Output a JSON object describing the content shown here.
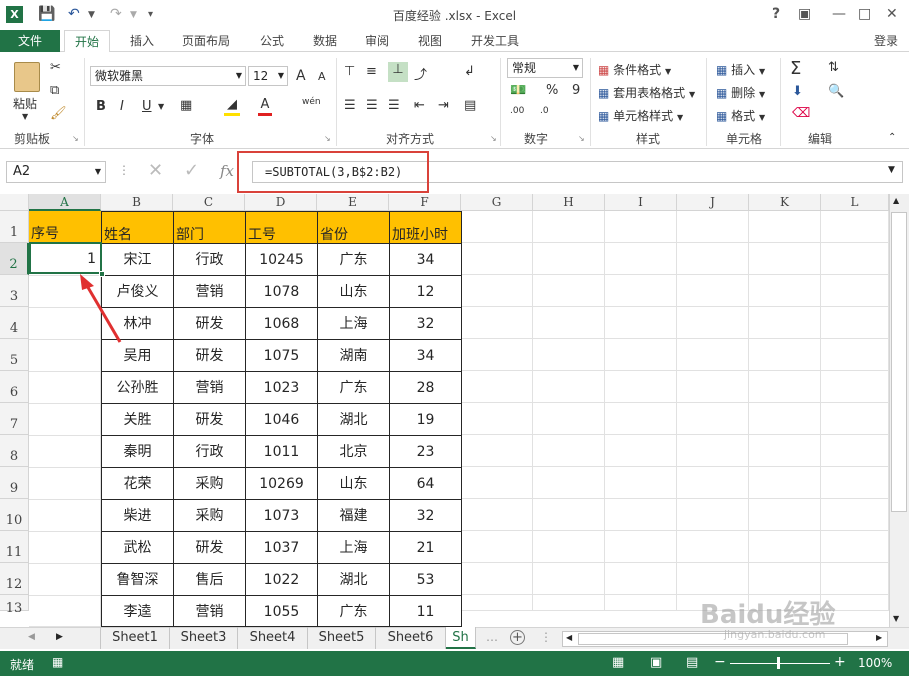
{
  "window": {
    "title": "百度经验 .xlsx - Excel",
    "help": "?",
    "login": "登录"
  },
  "menu": {
    "file": "文件",
    "tabs": [
      "开始",
      "插入",
      "页面布局",
      "公式",
      "数据",
      "审阅",
      "视图",
      "开发工具"
    ]
  },
  "ribbon": {
    "clipboard": {
      "paste": "粘贴",
      "label": "剪贴板"
    },
    "font": {
      "name": "微软雅黑",
      "size": "12",
      "bold": "B",
      "italic": "I",
      "underline": "U",
      "label": "字体",
      "grow": "A",
      "shrink": "A",
      "color_a": "A",
      "phonetic": "wén"
    },
    "align": {
      "label": "对齐方式"
    },
    "number": {
      "format": "常规",
      "percent": "%",
      "comma": "9",
      "label": "数字",
      "inc": ".00",
      "dec": ".0"
    },
    "styles": {
      "cond": "条件格式",
      "table": "套用表格格式",
      "cell": "单元格样式",
      "label": "样式"
    },
    "cells": {
      "insert": "插入",
      "delete": "删除",
      "format": "格式",
      "label": "单元格"
    },
    "edit": {
      "label": "编辑"
    }
  },
  "formula_bar": {
    "name_box": "A2",
    "fx": "fx",
    "formula": "=SUBTOTAL(3,B$2:B2)"
  },
  "sheet": {
    "columns": [
      "A",
      "B",
      "C",
      "D",
      "E",
      "F",
      "G",
      "H",
      "I",
      "J",
      "K",
      "L"
    ],
    "row_numbers": [
      "1",
      "2",
      "3",
      "4",
      "5",
      "6",
      "7",
      "8",
      "9",
      "10",
      "11",
      "12",
      "13"
    ],
    "headers": [
      "序号",
      "姓名",
      "部门",
      "工号",
      "省份",
      "加班小时"
    ],
    "rows": [
      [
        "1",
        "宋江",
        "行政",
        "10245",
        "广东",
        "34"
      ],
      [
        "",
        "卢俊义",
        "营销",
        "1078",
        "山东",
        "12"
      ],
      [
        "",
        "林冲",
        "研发",
        "1068",
        "上海",
        "32"
      ],
      [
        "",
        "吴用",
        "研发",
        "1075",
        "湖南",
        "34"
      ],
      [
        "",
        "公孙胜",
        "营销",
        "1023",
        "广东",
        "28"
      ],
      [
        "",
        "关胜",
        "研发",
        "1046",
        "湖北",
        "19"
      ],
      [
        "",
        "秦明",
        "行政",
        "1011",
        "北京",
        "23"
      ],
      [
        "",
        "花荣",
        "采购",
        "10269",
        "山东",
        "64"
      ],
      [
        "",
        "柴进",
        "采购",
        "1073",
        "福建",
        "32"
      ],
      [
        "",
        "武松",
        "研发",
        "1037",
        "上海",
        "21"
      ],
      [
        "",
        "鲁智深",
        "售后",
        "1022",
        "湖北",
        "53"
      ],
      [
        "",
        "李逵",
        "营销",
        "1055",
        "广东",
        "11"
      ]
    ]
  },
  "sheet_tabs": [
    "Sheet1",
    "Sheet3",
    "Sheet4",
    "Sheet5",
    "Sheet6",
    "Sh"
  ],
  "status": {
    "ready": "就绪",
    "zoom": "100%"
  },
  "watermark": {
    "brand": "Baidu经验",
    "url": "jingyan.baidu.com"
  }
}
